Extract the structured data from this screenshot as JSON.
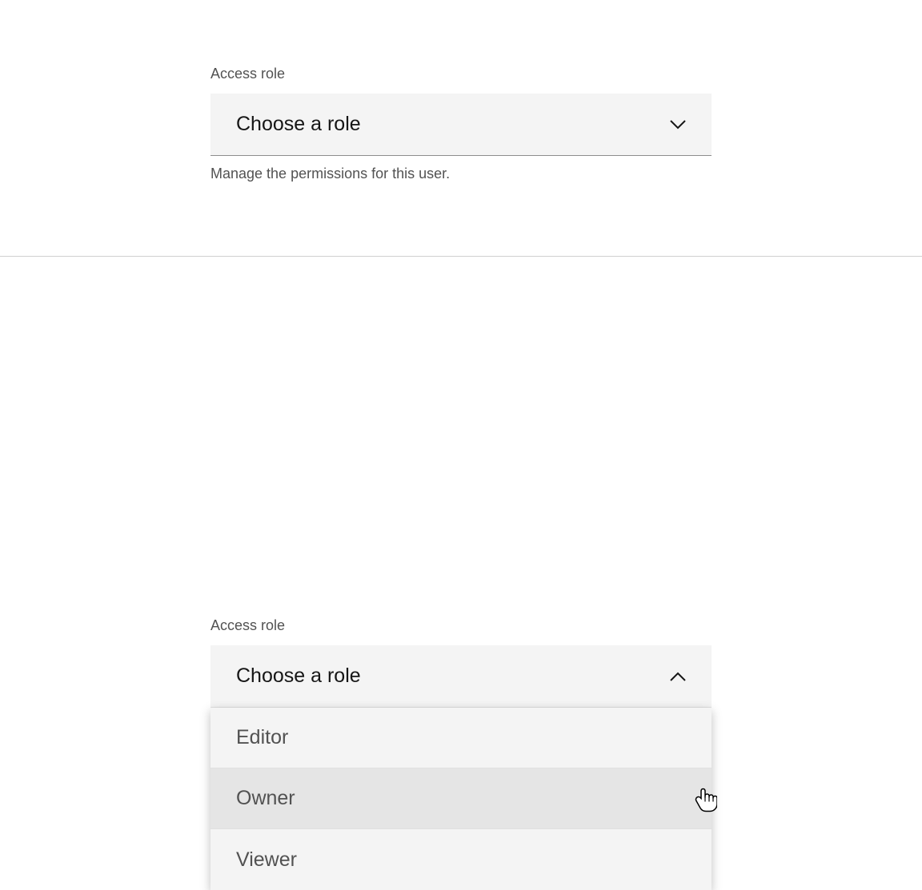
{
  "closed_state": {
    "label": "Access role",
    "placeholder": "Choose a role",
    "helper": "Manage the permissions for this user."
  },
  "open_state": {
    "label": "Access role",
    "placeholder": "Choose a role",
    "options": [
      {
        "label": "Editor"
      },
      {
        "label": "Owner"
      },
      {
        "label": "Viewer"
      }
    ]
  }
}
